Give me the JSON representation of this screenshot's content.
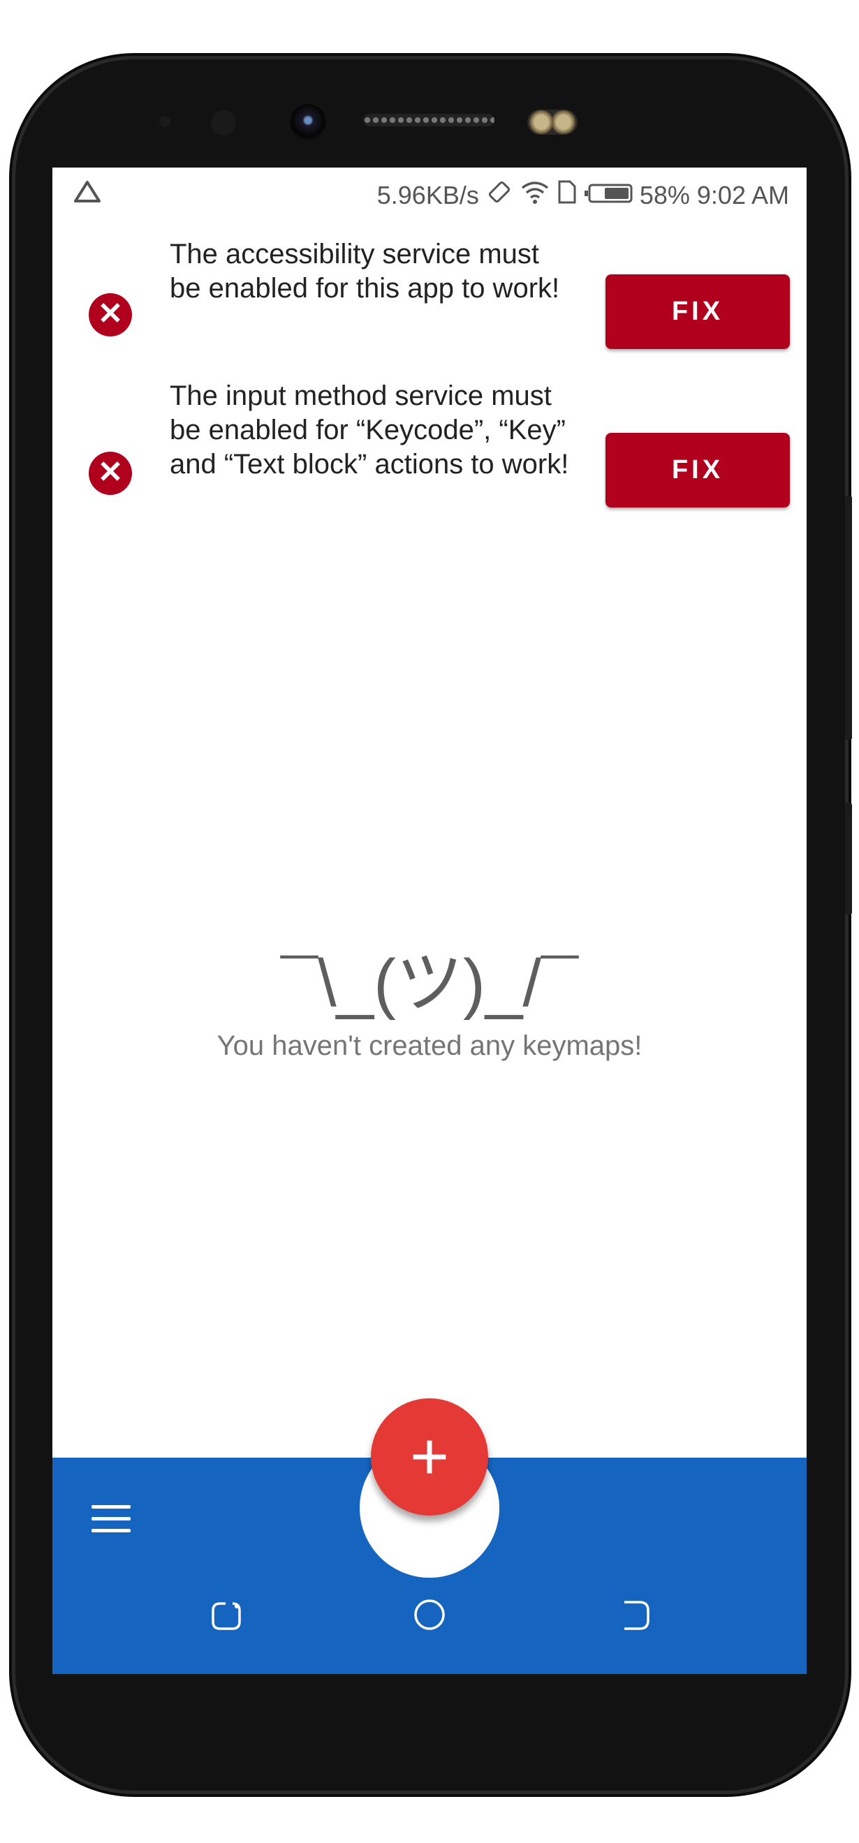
{
  "status_bar": {
    "network_speed": "5.96KB/s",
    "battery": "58%",
    "time": "9:02 AM",
    "icons": [
      "app-notification-icon",
      "rotate-icon",
      "wifi-icon",
      "sim-icon",
      "battery-icon"
    ]
  },
  "warnings": [
    {
      "message": "The accessibility service must be enabled for this app to work!",
      "button": "FIX"
    },
    {
      "message": "The input method service must be enabled for “Keycode”, “Key” and “Text block” actions to work!",
      "button": "FIX"
    }
  ],
  "empty_state": {
    "emoticon": "¯\\_(ツ)_/¯",
    "message": "You haven't created any keymaps!"
  },
  "fab": {
    "label": "+"
  },
  "colors": {
    "error": "#b0001e",
    "bottom_bar": "#1565c0",
    "fab": "#e53935"
  },
  "nav_icons": [
    "recents-icon",
    "home-icon",
    "back-icon"
  ]
}
